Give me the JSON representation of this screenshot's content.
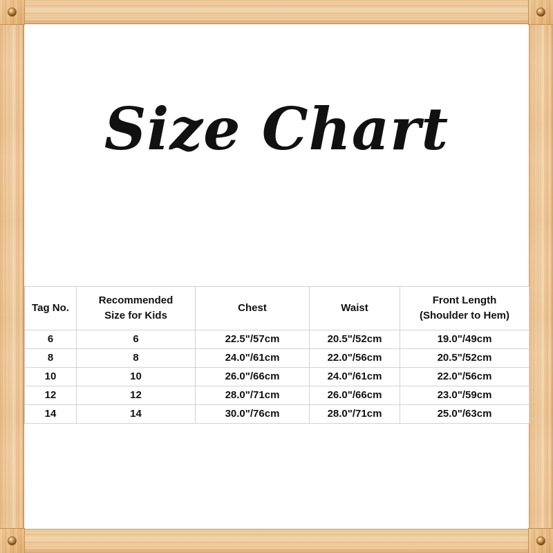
{
  "page": {
    "title_text": "Size Chart",
    "background_color": "#ffffff",
    "frame_color": "#f0c793",
    "frame_shadow_color": "#c9935a",
    "text_color": "#111111",
    "table_border_color": "#d2d2d2"
  },
  "frame": {
    "screw_tl": "screw-icon",
    "screw_tr": "screw-icon",
    "screw_bl": "screw-icon",
    "screw_br": "screw-icon"
  },
  "chart_data": {
    "type": "table",
    "title": "Size Chart",
    "columns": [
      {
        "key": "tag_no",
        "label_lines": [
          "Tag No."
        ]
      },
      {
        "key": "recommended_size",
        "label_lines": [
          "Recommended",
          "Size for Kids"
        ]
      },
      {
        "key": "chest",
        "label_lines": [
          "Chest"
        ]
      },
      {
        "key": "waist",
        "label_lines": [
          "Waist"
        ]
      },
      {
        "key": "front_length",
        "label_lines": [
          "Front Length",
          "(Shoulder to Hem)"
        ]
      }
    ],
    "rows": [
      {
        "tag_no": "6",
        "recommended_size": "6",
        "chest": "22.5\"/57cm",
        "waist": "20.5\"/52cm",
        "front_length": "19.0\"/49cm"
      },
      {
        "tag_no": "8",
        "recommended_size": "8",
        "chest": "24.0\"/61cm",
        "waist": "22.0\"/56cm",
        "front_length": "20.5\"/52cm"
      },
      {
        "tag_no": "10",
        "recommended_size": "10",
        "chest": "26.0\"/66cm",
        "waist": "24.0\"/61cm",
        "front_length": "22.0\"/56cm"
      },
      {
        "tag_no": "12",
        "recommended_size": "12",
        "chest": "28.0\"/71cm",
        "waist": "26.0\"/66cm",
        "front_length": "23.0\"/59cm"
      },
      {
        "tag_no": "14",
        "recommended_size": "14",
        "chest": "30.0\"/76cm",
        "waist": "28.0\"/71cm",
        "front_length": "25.0\"/63cm"
      }
    ]
  }
}
